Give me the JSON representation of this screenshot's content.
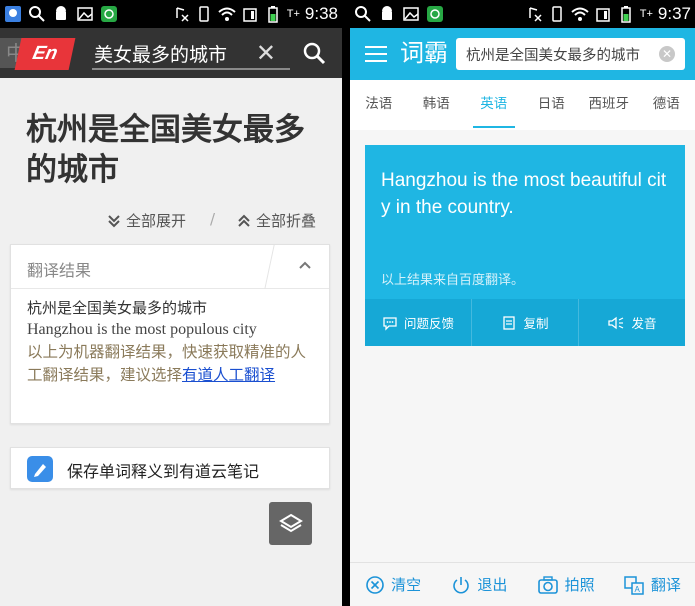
{
  "left": {
    "statusbar": {
      "time": "9:38",
      "network": "T+"
    },
    "topbar": {
      "lang_zh": "中",
      "lang_en": "En",
      "search_value": "美女最多的城市",
      "clear_glyph": "✕"
    },
    "title": "杭州是全国美女最多的城市",
    "expand_all": "全部展开",
    "separator": "/",
    "collapse_all": "全部折叠",
    "card": {
      "title": "翻译结果",
      "source_text": "杭州是全国美女最多的城市",
      "translation": "Hangzhou is the most populous city",
      "note_prefix": "以上为机器翻译结果，快速获取精准的人工翻译结果，建议选择",
      "note_link": "有道人工翻译"
    },
    "save_label": "保存单词释义到有道云笔记"
  },
  "right": {
    "statusbar": {
      "time": "9:37",
      "network": "T+"
    },
    "header": {
      "logo": "词霸",
      "search_value": "杭州是全国美女最多的城市"
    },
    "tabs": [
      {
        "label": "法语"
      },
      {
        "label": "韩语"
      },
      {
        "label": "英语"
      },
      {
        "label": "日语"
      },
      {
        "label": "西班牙"
      },
      {
        "label": "德语"
      }
    ],
    "result": {
      "text": "Hangzhou is the most beautiful city in the country.",
      "source_note": "以上结果来自百度翻译。",
      "actions": [
        {
          "label": "问题反馈",
          "icon": "feedback-icon"
        },
        {
          "label": "复制",
          "icon": "copy-icon"
        },
        {
          "label": "发音",
          "icon": "speaker-icon"
        }
      ]
    },
    "bottom": [
      {
        "label": "清空",
        "icon": "clear-icon"
      },
      {
        "label": "退出",
        "icon": "power-icon"
      },
      {
        "label": "拍照",
        "icon": "camera-icon"
      },
      {
        "label": "翻译",
        "icon": "translate-icon"
      }
    ]
  },
  "colors": {
    "accent": "#1fb6e3",
    "en_badge": "#e8353a",
    "link": "#1a4fd0"
  }
}
